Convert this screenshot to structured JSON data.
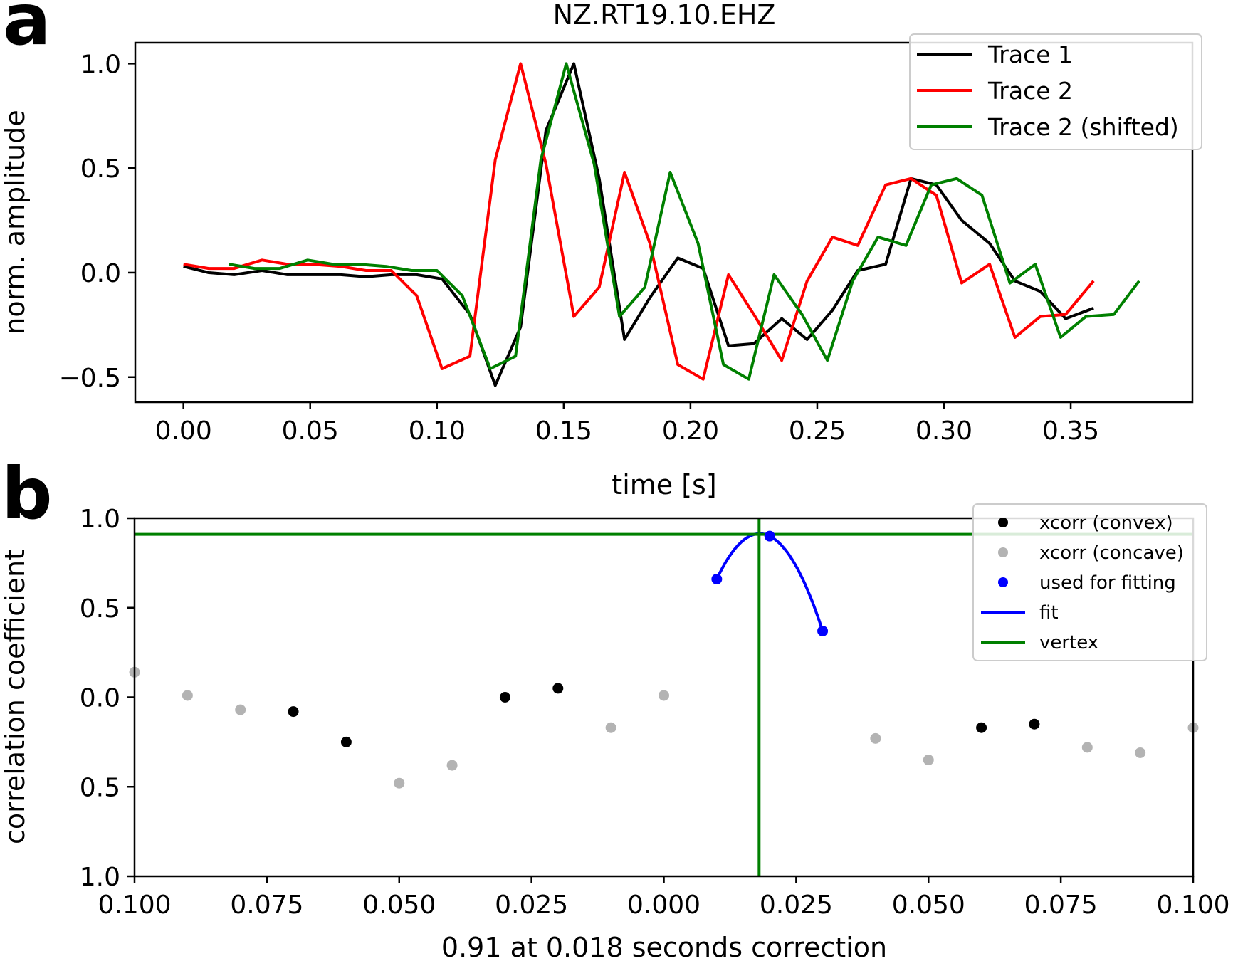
{
  "chart_data": [
    {
      "panel_label": "a",
      "type": "line",
      "title": "NZ.RT19.10.EHZ",
      "xlabel": "time [s]",
      "ylabel": "norm. amplitude",
      "xlim": [
        -0.019,
        0.398
      ],
      "ylim": [
        -0.62,
        1.1
      ],
      "xticks": [
        0.0,
        0.05,
        0.1,
        0.15,
        0.2,
        0.25,
        0.3,
        0.35
      ],
      "xtick_labels": [
        "0.00",
        "0.05",
        "0.10",
        "0.15",
        "0.20",
        "0.25",
        "0.30",
        "0.35"
      ],
      "yticks": [
        -0.5,
        0.0,
        0.5,
        1.0
      ],
      "ytick_labels": [
        "−0.5",
        "0.0",
        "0.5",
        "1.0"
      ],
      "legend_position": "top-right",
      "series": [
        {
          "name": "Trace 1",
          "color": "#000000",
          "x": [
            0.0,
            0.01,
            0.02,
            0.031,
            0.041,
            0.051,
            0.062,
            0.072,
            0.082,
            0.092,
            0.102,
            0.113,
            0.123,
            0.133,
            0.143,
            0.154,
            0.164,
            0.174,
            0.184,
            0.195,
            0.205,
            0.215,
            0.225,
            0.236,
            0.246,
            0.256,
            0.266,
            0.277,
            0.287,
            0.297,
            0.307,
            0.318,
            0.328,
            0.338,
            0.348,
            0.359
          ],
          "y": [
            0.03,
            0.0,
            -0.01,
            0.01,
            -0.01,
            -0.01,
            -0.01,
            -0.02,
            -0.01,
            -0.01,
            -0.03,
            -0.2,
            -0.54,
            -0.26,
            0.68,
            1.0,
            0.45,
            -0.32,
            -0.12,
            0.07,
            0.02,
            -0.35,
            -0.34,
            -0.22,
            -0.32,
            -0.18,
            0.01,
            0.04,
            0.45,
            0.42,
            0.25,
            0.14,
            -0.04,
            -0.09,
            -0.22,
            -0.17
          ]
        },
        {
          "name": "Trace 2",
          "color": "#ff0000",
          "x": [
            0.0,
            0.01,
            0.02,
            0.031,
            0.041,
            0.051,
            0.062,
            0.072,
            0.082,
            0.092,
            0.102,
            0.113,
            0.123,
            0.133,
            0.143,
            0.154,
            0.164,
            0.174,
            0.184,
            0.195,
            0.205,
            0.215,
            0.225,
            0.236,
            0.246,
            0.256,
            0.266,
            0.277,
            0.287,
            0.297,
            0.307,
            0.318,
            0.328,
            0.338,
            0.348,
            0.359
          ],
          "y": [
            0.04,
            0.02,
            0.02,
            0.06,
            0.04,
            0.04,
            0.03,
            0.01,
            0.01,
            -0.11,
            -0.46,
            -0.4,
            0.54,
            1.0,
            0.52,
            -0.21,
            -0.07,
            0.48,
            0.14,
            -0.44,
            -0.51,
            -0.01,
            -0.2,
            -0.42,
            -0.04,
            0.17,
            0.13,
            0.42,
            0.45,
            0.37,
            -0.05,
            0.04,
            -0.31,
            -0.21,
            -0.2,
            -0.04
          ]
        },
        {
          "name": "Trace 2 (shifted)",
          "color": "#008000",
          "x": [
            0.018,
            0.028,
            0.038,
            0.049,
            0.059,
            0.069,
            0.08,
            0.09,
            0.1,
            0.11,
            0.121,
            0.131,
            0.141,
            0.151,
            0.162,
            0.172,
            0.182,
            0.192,
            0.203,
            0.213,
            0.223,
            0.233,
            0.244,
            0.254,
            0.264,
            0.274,
            0.285,
            0.295,
            0.305,
            0.315,
            0.326,
            0.336,
            0.346,
            0.356,
            0.367,
            0.377
          ],
          "y": [
            0.04,
            0.02,
            0.02,
            0.06,
            0.04,
            0.04,
            0.03,
            0.01,
            0.01,
            -0.11,
            -0.46,
            -0.4,
            0.54,
            1.0,
            0.52,
            -0.21,
            -0.07,
            0.48,
            0.14,
            -0.44,
            -0.51,
            -0.01,
            -0.2,
            -0.42,
            -0.04,
            0.17,
            0.13,
            0.42,
            0.45,
            0.37,
            -0.05,
            0.04,
            -0.31,
            -0.21,
            -0.2,
            -0.04
          ]
        }
      ]
    },
    {
      "panel_label": "b",
      "type": "scatter",
      "xlabel": "0.91 at 0.018 seconds correction",
      "ylabel": "correlation coefficient",
      "xlim": [
        -0.1,
        0.1
      ],
      "ylim": [
        -1.0,
        1.0
      ],
      "xticks": [
        -0.1,
        -0.075,
        -0.05,
        -0.025,
        0.0,
        0.025,
        0.05,
        0.075,
        0.1
      ],
      "xtick_labels": [
        "0.100",
        "0.075",
        "0.050",
        "0.025",
        "0.000",
        "0.025",
        "0.050",
        "0.075",
        "0.100"
      ],
      "yticks": [
        -1.0,
        -0.5,
        0.0,
        0.5,
        1.0
      ],
      "ytick_labels": [
        "1.0",
        "0.5",
        "0.0",
        "0.5",
        "1.0"
      ],
      "legend_position": "top-right",
      "series": [
        {
          "name": "xcorr (convex)",
          "color": "#000000",
          "x": [
            -0.07,
            -0.06,
            -0.03,
            -0.02,
            0.06,
            0.07
          ],
          "y": [
            -0.08,
            -0.25,
            0.0,
            0.05,
            -0.17,
            -0.15
          ]
        },
        {
          "name": "xcorr (concave)",
          "color": "#b3b3b3",
          "x": [
            -0.1,
            -0.09,
            -0.08,
            -0.05,
            -0.04,
            -0.01,
            0.0,
            0.04,
            0.05,
            0.08,
            0.09,
            0.1
          ],
          "y": [
            0.14,
            0.01,
            -0.07,
            -0.48,
            -0.38,
            -0.17,
            0.01,
            -0.23,
            -0.35,
            -0.28,
            -0.31,
            -0.17
          ]
        },
        {
          "name": "used for fitting",
          "color": "#0000ff",
          "x": [
            0.01,
            0.02,
            0.03
          ],
          "y": [
            0.66,
            0.9,
            0.37
          ]
        }
      ],
      "fit": {
        "name": "fit",
        "color": "#0000ff",
        "x_range": [
          0.01,
          0.03
        ]
      },
      "vertex": {
        "name": "vertex",
        "color": "#008000",
        "x": 0.018,
        "y": 0.91
      }
    }
  ]
}
